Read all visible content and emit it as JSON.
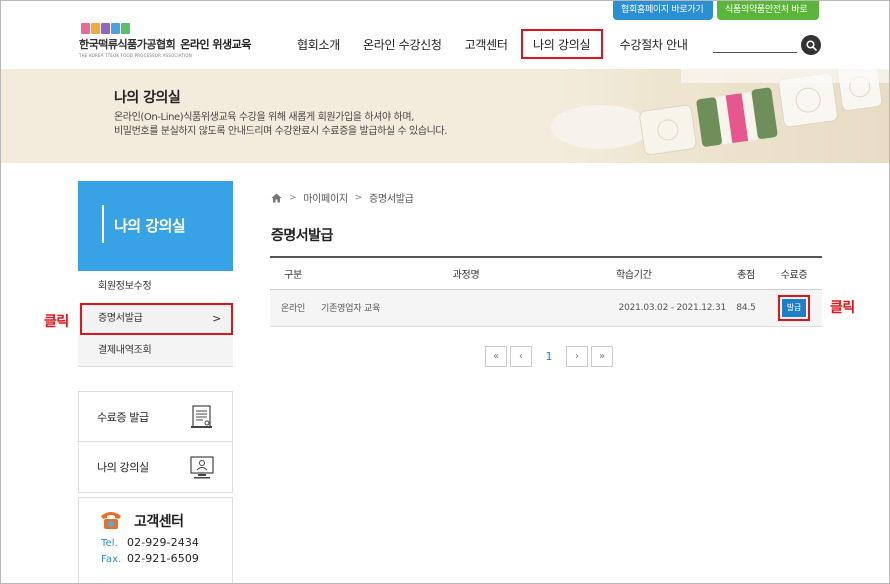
{
  "quick_links": [
    {
      "label": "협회홈페이지 바로가기  >"
    },
    {
      "label": "식품의약품안전처 바로가기 >"
    }
  ],
  "logo": {
    "name": "한국떡류식품가공협회",
    "service": "온라인 위생교육",
    "english": "THE KOREA TTEOK FOOD PROCESSOR ASSOCIATION"
  },
  "nav": [
    {
      "label": "협회소개"
    },
    {
      "label": "온라인 수강신청"
    },
    {
      "label": "고객센터"
    },
    {
      "label": "나의 강의실"
    },
    {
      "label": "수강절차 안내"
    }
  ],
  "search": {
    "placeholder": ""
  },
  "banner": {
    "title": "나의 강의실",
    "desc_line1": "온라인(On-Line)식품위생교육 수강을 위해 새롭게 회원가입을 하셔야 하며,",
    "desc_line2": "비밀번호를 분실하지 않도록 안내드리며 수강완료시 수료증을 발급하실 수 있습니다."
  },
  "sidebar": {
    "title": "나의 강의실",
    "menu": [
      {
        "label": "회원정보수정"
      },
      {
        "label": "증명서발급",
        "chevron": ">"
      },
      {
        "label": "결제내역조회"
      }
    ],
    "links": [
      {
        "label": "수료증 발급",
        "icon": "certificate-icon"
      },
      {
        "label": "나의 강의실",
        "icon": "monitor-user-icon"
      }
    ],
    "customer": {
      "title": "고객센터",
      "tel_key": "Tel.",
      "tel": "02-929-2434",
      "fax_key": "Fax.",
      "fax": "02-921-6509"
    }
  },
  "callouts": {
    "left": "클릭",
    "right": "클릭"
  },
  "breadcrumb": {
    "home_icon": "home-icon",
    "items": [
      "마이페이지",
      "증명서발급"
    ],
    "sep": ">"
  },
  "page_title": "증명서발급",
  "table": {
    "headers": [
      "구분",
      "과정명",
      "학습기간",
      "총점",
      "수료증"
    ],
    "rows": [
      {
        "type": "온라인",
        "course": "기존영업자 교육",
        "period": "2021.03.02 - 2021.12.31",
        "score": "84.5",
        "action": "발급"
      }
    ]
  },
  "pager": {
    "first": "«",
    "prev": "‹",
    "current": "1",
    "next": "›",
    "last": "»"
  },
  "colors": {
    "accent_blue": "#37a2e6",
    "highlight_red": "#e0141b",
    "banner_bg": "#f3ecdc",
    "link_green": "#5bb53b"
  }
}
